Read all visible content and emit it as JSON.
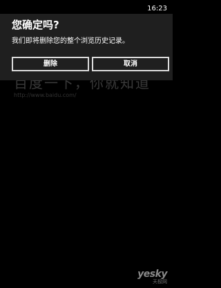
{
  "status_bar": {
    "time": "16:23"
  },
  "dialog": {
    "title": "您确定吗?",
    "message": "我们即将删除您的整个浏览历史记录。",
    "buttons": {
      "delete": "删除",
      "cancel": "取消"
    }
  },
  "background_page": {
    "slogan": "百度一下，你就知道",
    "url": "http://www.baidu.com/"
  },
  "watermark": {
    "brand": "yesky",
    "sub": "天极网"
  },
  "colors": {
    "dialog_background": "#1f1f1f",
    "button_border": "#dcdcdc",
    "screen_background": "#000000"
  }
}
